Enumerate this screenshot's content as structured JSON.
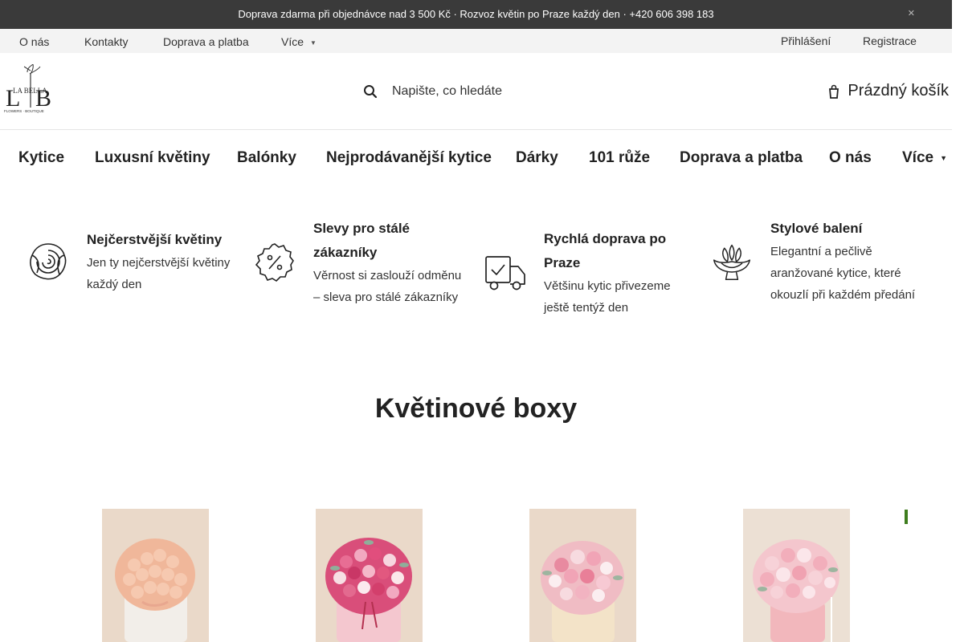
{
  "topbar": {
    "message": "Doprava zdarma při objednávce nad 3 500 Kč · Rozvoz květin po Praze každý den · +420 606 398 183",
    "close_icon": "close-icon"
  },
  "utility_nav": {
    "items": [
      "O nás",
      "Kontakty",
      "Doprava a platba",
      "Více"
    ],
    "login": "Přihlášení",
    "register": "Registrace"
  },
  "header": {
    "logo_text": "LA BELLA",
    "logo_sub": "FLOWERS BOUTIQUE",
    "search_placeholder": "Napište, co hledáte",
    "cart_label": "Prázdný košík"
  },
  "main_nav": {
    "items": [
      "Kytice",
      "Luxusní květiny",
      "Balónky",
      "Nejprodávanější kytice",
      "Dárky",
      "101 růže",
      "Doprava a platba",
      "O nás",
      "Více"
    ]
  },
  "features": [
    {
      "title": "Nejčerstvější květiny",
      "text": "Jen ty nejčerstvější květiny každý den",
      "icon": "rose-icon"
    },
    {
      "title": "Slevy pro stálé zákazníky",
      "text": "Věrnost si zaslouží odměnu – sleva pro stálé zákazníky",
      "icon": "discount-badge-icon"
    },
    {
      "title": "Rychlá doprava po Praze",
      "text": "Většinu kytic přivezeme ještě tentýž den",
      "icon": "delivery-truck-icon"
    },
    {
      "title": "Stylové balení",
      "text": "Elegantní a pečlivě aranžované kytice, které okouzlí při každém předání",
      "icon": "bouquet-icon"
    }
  ],
  "section": {
    "title": "Květinové boxy"
  },
  "products": [
    {
      "image": "peach-roses-box"
    },
    {
      "image": "pink-roses-box"
    },
    {
      "image": "pink-carnations-box"
    },
    {
      "image": "pink-carnations-hatbox"
    }
  ],
  "colors": {
    "topbar_bg": "#3a3a3a",
    "utilbar_bg": "#f3f3f3",
    "accent_green": "#3e7d1e",
    "product_bg": "#e9dccf"
  }
}
